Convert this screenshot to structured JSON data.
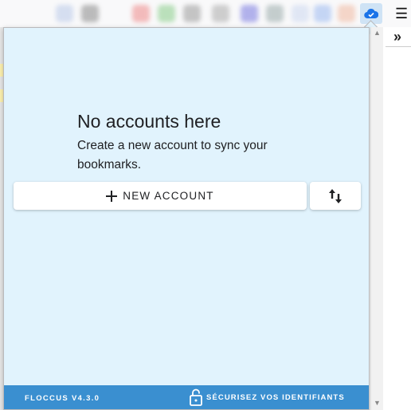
{
  "popup": {
    "empty_title": "No accounts here",
    "empty_description": "Create a new account to sync your bookmarks.",
    "new_account_button": {
      "icon": "plus-icon",
      "label": "NEW ACCOUNT"
    },
    "import_export_button": {
      "icon": "import-export-arrows-icon"
    },
    "footer": {
      "version": "FLOCCUS V4.3.0",
      "secure_link": {
        "icon": "unlock-icon",
        "label": "SÉCURISEZ VOS IDENTIFIANTS"
      }
    },
    "colors": {
      "background": "#e1f3fd",
      "footer": "#3a8fd0",
      "accent_icon": "#1a73e8"
    }
  },
  "browser": {
    "extension_icon": "cloud-check-icon",
    "menu_icon": "hamburger-menu-icon",
    "overflow_icon": "chevrons-right-icon"
  }
}
